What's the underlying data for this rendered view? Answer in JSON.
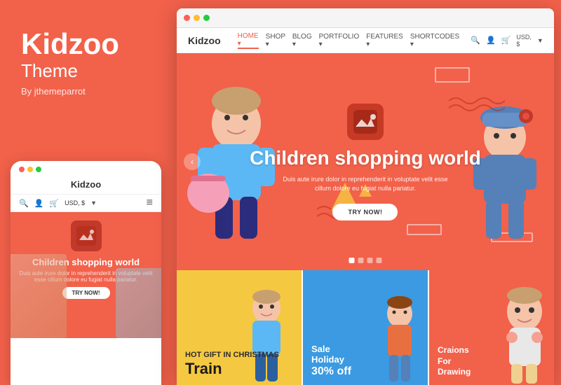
{
  "brand": {
    "name": "Kidzoo",
    "subtitle": "Theme",
    "author": "By jthemeparrot"
  },
  "browser_dots": [
    "#FF5F57",
    "#FFBD2E",
    "#28CA41"
  ],
  "site": {
    "logo": "Kidzoo",
    "nav_items": [
      {
        "label": "HOME",
        "active": true,
        "has_arrow": true
      },
      {
        "label": "SHOP",
        "active": false,
        "has_arrow": true
      },
      {
        "label": "BLOG",
        "active": false,
        "has_arrow": true
      },
      {
        "label": "PORTFOLIO",
        "active": false,
        "has_arrow": true
      },
      {
        "label": "FEATURES",
        "active": false,
        "has_arrow": true
      },
      {
        "label": "SHORTCODES",
        "active": false,
        "has_arrow": true
      }
    ],
    "nav_currency": "USD, $",
    "hero": {
      "title": "Children shopping world",
      "description": "Duis aute irure dolor in reprehenderit in voluptate velit esse cillum dolore eu fugiat nulla pariatur.",
      "cta_button": "TRY NOW!"
    },
    "products": [
      {
        "id": 1,
        "bg": "yellow",
        "label1": "HOT GIFT IN CHRISTMAS",
        "label2": "Train",
        "label2_size": "large"
      },
      {
        "id": 2,
        "bg": "blue",
        "label1": "Sale Holiday",
        "label2": "30% off",
        "label2_size": "medium"
      },
      {
        "id": 3,
        "bg": "orange",
        "label1": "Craions For Drawing",
        "label2": "",
        "label2_size": "small"
      }
    ]
  },
  "mobile": {
    "title": "Kidzoo",
    "hero_title": "Children shopping world",
    "hero_desc": "Duis aute irure dolor in reprehenderit in voluptate velit esse cillum dolore eu fugiat nulla pariatur.",
    "cta": "TRY NOW!"
  }
}
